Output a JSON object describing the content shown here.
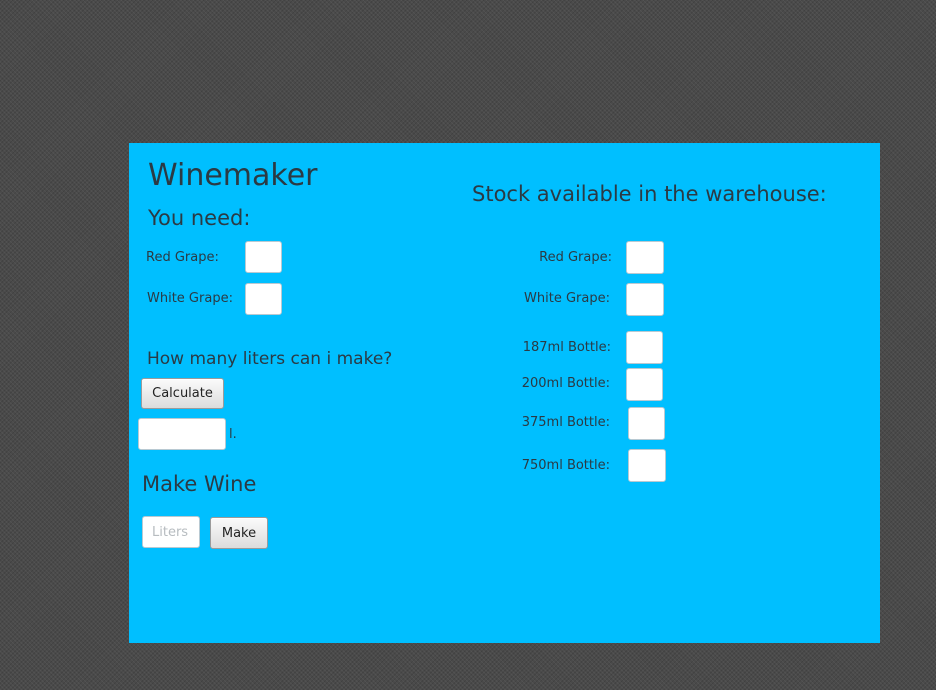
{
  "left": {
    "title": "Winemaker",
    "you_need": "You need:",
    "red_grape_label": "Red Grape:",
    "white_grape_label": "White Grape:",
    "question": "How many liters can i make?",
    "calculate_label": "Calculate",
    "liters_unit": "l.",
    "make_wine_heading": "Make Wine",
    "liters_placeholder": "Liters",
    "make_label": "Make"
  },
  "right": {
    "heading": "Stock available in the warehouse:",
    "red_grape_label": "Red Grape:",
    "white_grape_label": "White Grape:",
    "bottle_187_label": "187ml Bottle:",
    "bottle_200_label": "200ml Bottle:",
    "bottle_375_label": "375ml Bottle:",
    "bottle_750_label": "750ml Bottle:"
  },
  "colors": {
    "panel_background": "#00bfff",
    "window_background": "#4a4a4a",
    "text": "#2b3a44"
  }
}
